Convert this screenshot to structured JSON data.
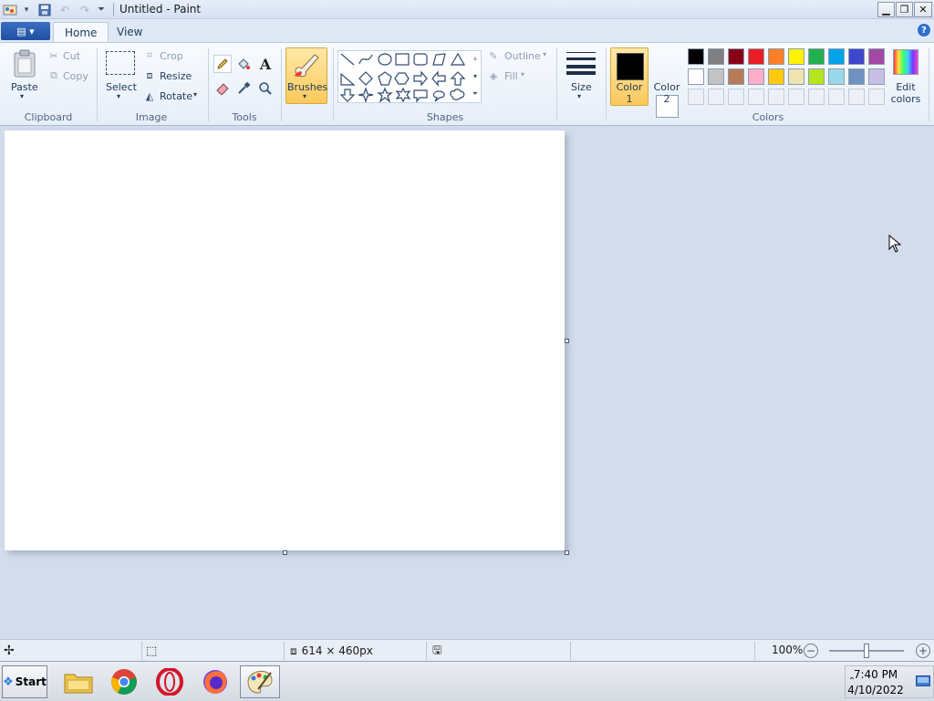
{
  "window": {
    "title": "Untitled - Paint",
    "minimize": "▁",
    "restore": "❐",
    "close": "✕"
  },
  "tabs": [
    {
      "label": "Home",
      "active": true
    },
    {
      "label": "View",
      "active": false
    }
  ],
  "file_button": "▤ ▾",
  "help_label": "?",
  "ribbon": {
    "clipboard": {
      "group_label": "Clipboard",
      "paste": "Paste",
      "cut": "Cut",
      "copy": "Copy"
    },
    "image": {
      "group_label": "Image",
      "select": "Select",
      "crop": "Crop",
      "resize": "Resize",
      "rotate": "Rotate"
    },
    "tools": {
      "group_label": "Tools"
    },
    "brushes": {
      "label": "Brushes"
    },
    "shapes": {
      "group_label": "Shapes",
      "outline": "Outline",
      "fill": "Fill"
    },
    "size": {
      "label": "Size"
    },
    "colors": {
      "group_label": "Colors",
      "color1_line1": "Color",
      "color1_line2": "1",
      "color2_line1": "Color",
      "color2_line2": "2",
      "edit_line1": "Edit",
      "edit_line2": "colors",
      "color1_value": "#000000",
      "color2_value": "#ffffff",
      "palette_row1": [
        "#000000",
        "#7f7f7f",
        "#880015",
        "#ed1c24",
        "#ff7f27",
        "#fff200",
        "#22b14c",
        "#00a2e8",
        "#3f48cc",
        "#a349a4"
      ],
      "palette_row2": [
        "#ffffff",
        "#c3c3c3",
        "#b97a57",
        "#ffaec9",
        "#ffc90e",
        "#efe4b0",
        "#b5e61d",
        "#99d9ea",
        "#7092be",
        "#c8bfe7"
      ]
    }
  },
  "statusbar": {
    "dimensions": "614 × 460px",
    "zoom": "100%",
    "zoom_level": 1.0
  },
  "taskbar": {
    "start": "Start",
    "time": "7:40 PM",
    "date": "4/10/2022"
  }
}
